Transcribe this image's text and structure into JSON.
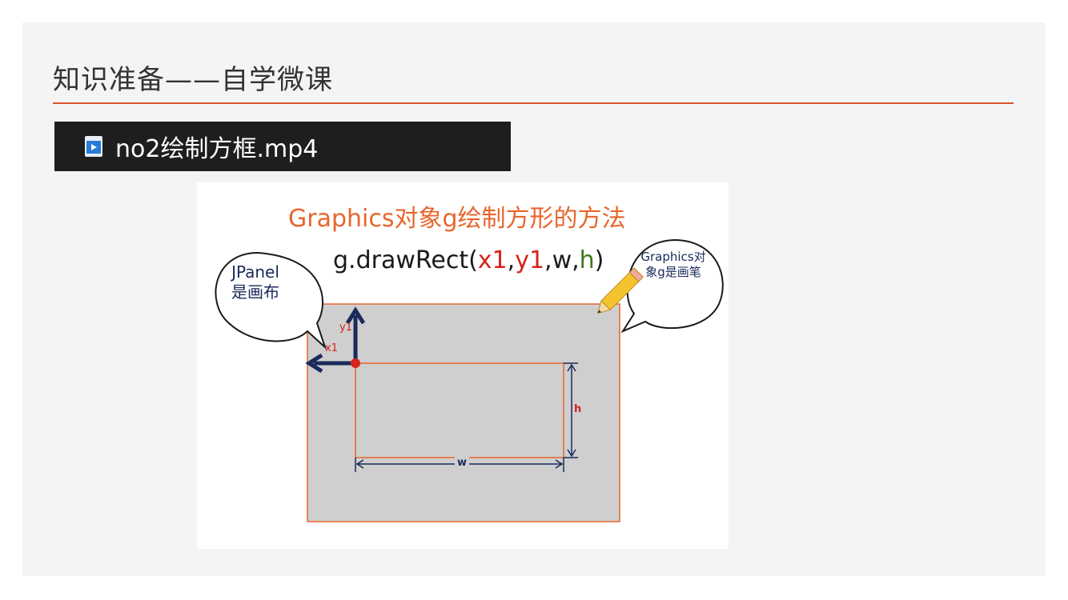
{
  "slide": {
    "title": "知识准备——自学微课"
  },
  "file": {
    "icon": "video-file-icon",
    "name": "no2绘制方框.mp4"
  },
  "figure": {
    "title": "Graphics对象g绘制方形的方法",
    "code": {
      "prefix": "g.drawRect(",
      "x1": "x1",
      "sep1": ",",
      "y1": "y1",
      "sep2": ",w,",
      "h": "h",
      "suffix": ")"
    },
    "bubble_left": {
      "line1": "JPanel",
      "line2": "是画布"
    },
    "bubble_right": {
      "line1": "Graphics对",
      "line2": "象g是画笔"
    },
    "labels": {
      "x1": "x1",
      "y1": "y1",
      "w": "w",
      "h": "h"
    },
    "colors": {
      "accent": "#d9532b",
      "title_orange": "#e8652c",
      "red": "#d4241c",
      "green": "#3d7a1f",
      "navy": "#1a2a5a",
      "panel_gray": "#cfcfcf"
    }
  }
}
